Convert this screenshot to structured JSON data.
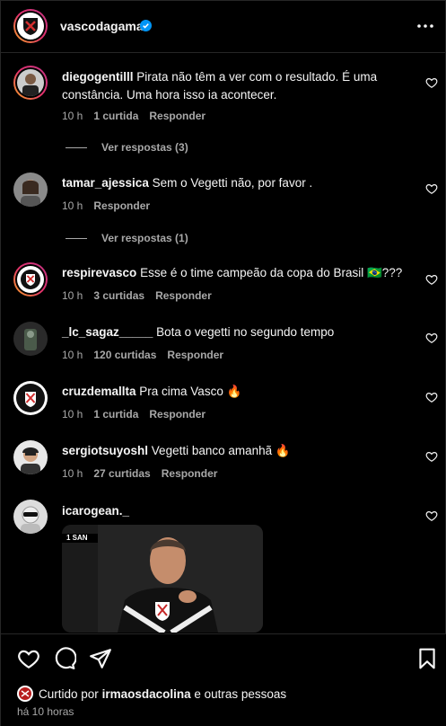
{
  "post": {
    "username": "vascodagama",
    "verified": true
  },
  "comments": [
    {
      "user": "diegogentilll",
      "text": "Pirata não têm a ver com o resultado. É uma constância. Uma hora isso ia acontecer.",
      "time": "10 h",
      "likes": "1 curtida",
      "reply": "Responder",
      "view_replies": "Ver respostas (3)"
    },
    {
      "user": "tamar_ajessica",
      "text": "Sem o Vegetti não, por favor .",
      "time": "10 h",
      "likes": "",
      "reply": "Responder",
      "view_replies": "Ver respostas (1)"
    },
    {
      "user": "respirevasco",
      "text": "Esse é o time campeão da copa do Brasil 🇧🇷???",
      "time": "10 h",
      "likes": "3 curtidas",
      "reply": "Responder"
    },
    {
      "user": "_lc_sagaz_____",
      "text": "Bota o vegetti no segundo tempo",
      "time": "10 h",
      "likes": "120 curtidas",
      "reply": "Responder"
    },
    {
      "user": "cruzdemallta",
      "text": "Pra cima Vasco 🔥",
      "time": "10 h",
      "likes": "1 curtida",
      "reply": "Responder"
    },
    {
      "user": "sergiotsuyoshl",
      "text": "Vegetti banco amanhã 🔥",
      "time": "10 h",
      "likes": "27 curtidas",
      "reply": "Responder"
    },
    {
      "user": "icarogean._",
      "text": ""
    }
  ],
  "gif": {
    "overlay_text": "1 SAN"
  },
  "footer": {
    "liked_prefix": "Curtido por",
    "liked_user": "irmaosdacolina",
    "liked_suffix": "e outras pessoas",
    "time": "há 10 horas"
  },
  "colors": {
    "background": "#000000",
    "text": "#f5f5f5",
    "muted": "#a8a8a8",
    "verified": "#0095f6"
  },
  "icons": [
    "more-options-icon",
    "heart-icon",
    "comment-icon",
    "share-icon",
    "bookmark-icon",
    "verified-badge-icon"
  ]
}
